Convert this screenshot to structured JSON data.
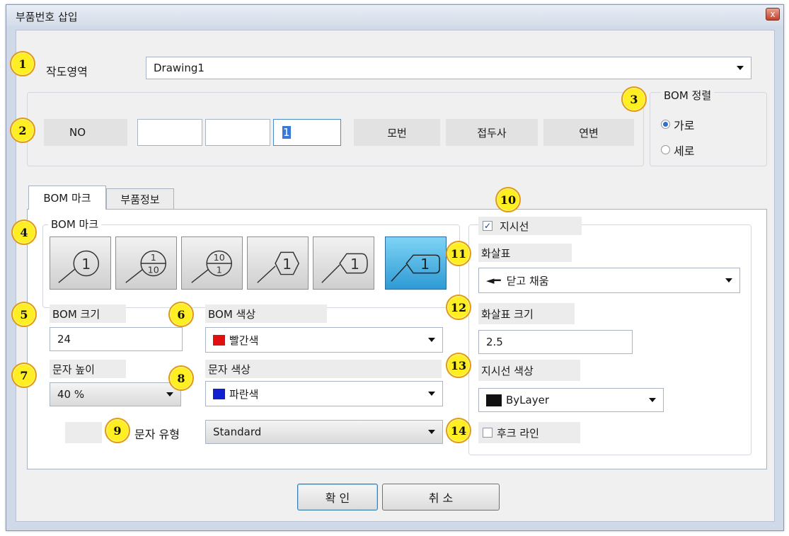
{
  "dialog": {
    "title": "부품번호 삽입",
    "close_glyph": "x"
  },
  "drawing_area": {
    "label": "작도영역",
    "value": "Drawing1"
  },
  "number_row": {
    "no_label": "NO",
    "field1": "",
    "field2": "",
    "field3": "1",
    "col_labels": [
      "모번",
      "접두사",
      "연변"
    ]
  },
  "bom_sort": {
    "label": "BOM 정렬",
    "options": [
      "가로",
      "세로"
    ],
    "selected": "가로"
  },
  "tabs": [
    "BOM 마크",
    "부품정보"
  ],
  "bom_mark": {
    "group_label": "BOM 마크",
    "marks": [
      "1",
      "1/10",
      "10/1",
      "1",
      "1",
      "1"
    ],
    "selected_index": 5
  },
  "bom_size": {
    "label": "BOM 크기",
    "value": "24"
  },
  "bom_color": {
    "label": "BOM 색상",
    "value": "빨간색",
    "color": "#e01010"
  },
  "text_height": {
    "label": "문자 높이",
    "value": "40 %"
  },
  "text_color": {
    "label": "문자 색상",
    "value": "파란색",
    "color": "#1020d0"
  },
  "text_style": {
    "label": "문자 유형",
    "value": "Standard"
  },
  "leader": {
    "enabled_label": "지시선",
    "enabled": true,
    "arrow_label": "화살표",
    "arrow_value": "닫고 채움",
    "arrow_glyph": "◄━",
    "arrow_size_label": "화살표 크기",
    "arrow_size_value": "2.5",
    "color_label": "지시선 색상",
    "color_value": "ByLayer",
    "color": "#111111",
    "hook_label": "후크 라인",
    "hook_checked": false
  },
  "buttons": {
    "ok": "확 인",
    "cancel": "취 소"
  },
  "callouts": [
    "1",
    "2",
    "3",
    "4",
    "5",
    "6",
    "7",
    "8",
    "9",
    "10",
    "11",
    "12",
    "13",
    "14"
  ],
  "check_glyph": "✓"
}
